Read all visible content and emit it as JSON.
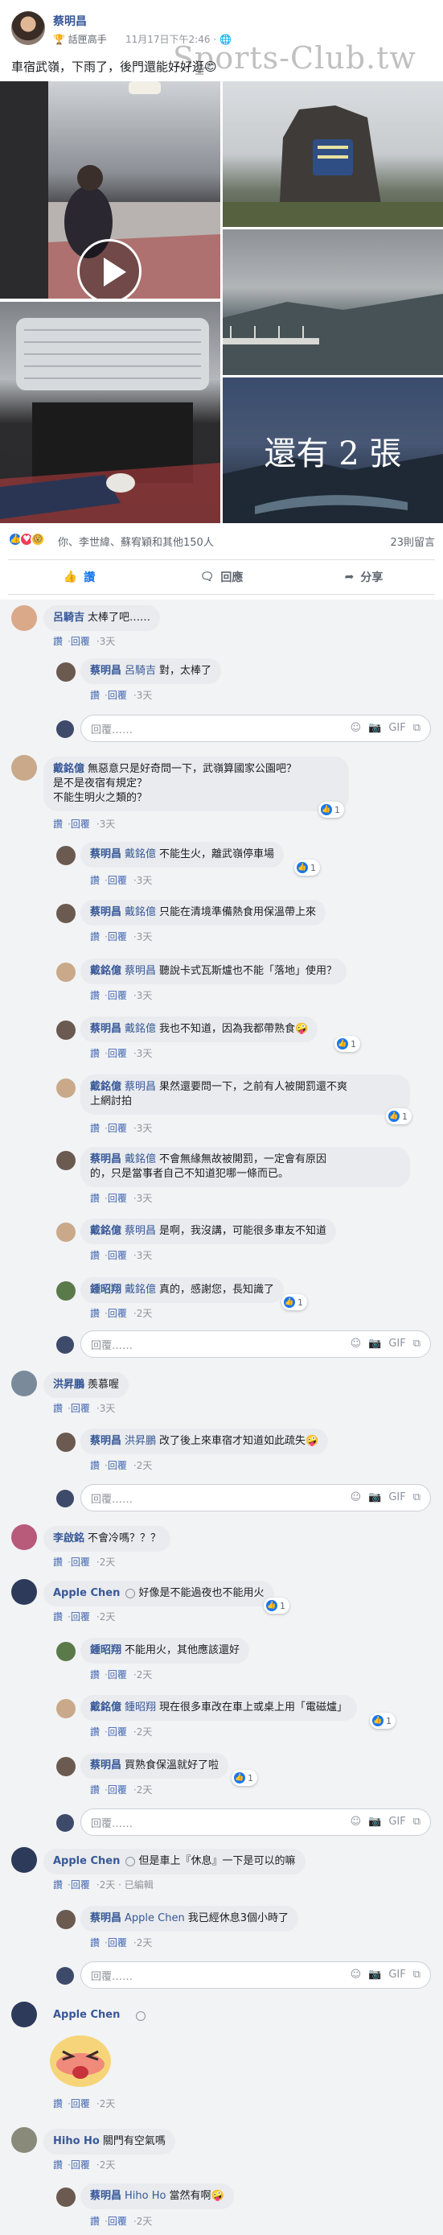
{
  "post": {
    "author": "蔡明昌",
    "badge": "話匣高手",
    "time": "11月17日下午2:46",
    "watermark": "Sports-Club.tw",
    "text": "車宿武嶺，下雨了，後門還能好好逛😊",
    "more_photos": "還有 2 張"
  },
  "reactions": {
    "summary": "你、李世緯、蘇宥穎和其他150人",
    "comment_count": "23則留言"
  },
  "actions": {
    "like": "讚",
    "comment": "回應",
    "share": "分享"
  },
  "ui": {
    "like": "讚",
    "reply": "回覆",
    "reply_placeholder": "回覆……",
    "edited": "已編輯"
  },
  "comments": [
    {
      "name": "呂騎吉",
      "text": "太棒了吧……",
      "time": "3天"
    },
    {
      "name": "蔡明昌",
      "tag": "呂騎吉",
      "text": "對，太棒了",
      "time": "3天"
    },
    {
      "name": "戴銘億",
      "text": "無惡意只是好奇問一下，武嶺算國家公園吧？",
      "text2": "是不是夜宿有規定？",
      "text3": "不能生明火之類的？",
      "likes": "1",
      "time": "3天"
    },
    {
      "name": "蔡明昌",
      "tag": "戴銘億",
      "text": "不能生火，離武嶺停車場",
      "likes": "1",
      "time": "3天"
    },
    {
      "name": "蔡明昌",
      "tag": "戴銘億",
      "text": "只能在清境準備熱食用保溫帶上來",
      "time": "3天"
    },
    {
      "name": "戴銘億",
      "tag": "蔡明昌",
      "text": "聽說卡式瓦斯爐也不能「落地」使用？",
      "time": "3天"
    },
    {
      "name": "蔡明昌",
      "tag": "戴銘億",
      "text": "我也不知道，因為我都帶熟食🤪",
      "likes": "1",
      "time": "3天"
    },
    {
      "name": "戴銘億",
      "tag": "蔡明昌",
      "text": "果然還要問一下，之前有人被開罰還不爽",
      "text2": "上網討拍",
      "likes": "1",
      "time": "3天"
    },
    {
      "name": "蔡明昌",
      "tag": "戴銘億",
      "text": "不會無緣無故被開罰，一定會有原因",
      "text2": "的，只是當事者自己不知道犯哪一條而已。",
      "time": "3天"
    },
    {
      "name": "戴銘億",
      "tag": "蔡明昌",
      "text": "是啊，我沒講，可能很多車友不知道",
      "time": "3天"
    },
    {
      "name": "鍾昭翔",
      "tag": "戴銘億",
      "text": "真的，感謝您，長知識了",
      "likes": "1",
      "time": "2天"
    },
    {
      "name": "洪昇鵬",
      "text": "羨慕喔",
      "time": "3天"
    },
    {
      "name": "蔡明昌",
      "tag": "洪昇鵬",
      "text": "改了後上來車宿才知道如此疏失🤪",
      "time": "2天"
    },
    {
      "name": "李啟銘",
      "text": "不會冷嗎？？？",
      "time": "2天"
    },
    {
      "name": "Apple Chen",
      "text": "好像是不能過夜也不能用火",
      "likes": "1",
      "time": "2天"
    },
    {
      "name": "鍾昭翔",
      "text": "不能用火，其他應該還好",
      "time": "2天"
    },
    {
      "name": "戴銘億",
      "tag": "鍾昭翔",
      "text": "現在很多車改在車上或桌上用「電磁爐」",
      "likes": "1",
      "time": "2天"
    },
    {
      "name": "蔡明昌",
      "text": "買熟食保溫就好了啦",
      "likes": "1",
      "time": "2天"
    },
    {
      "name": "Apple Chen",
      "text": "但是車上『休息』一下是可以的嘛",
      "time": "2天"
    },
    {
      "name": "蔡明昌",
      "tag": "Apple Chen",
      "text": "我已經休息3個小時了",
      "time": "2天"
    },
    {
      "name": "Apple Chen",
      "time": "2天"
    },
    {
      "name": "Hiho Ho",
      "text": "關門有空氣嗎",
      "time": "2天"
    },
    {
      "name": "蔡明昌",
      "tag": "Hiho Ho",
      "text": "當然有啊🤪",
      "time": "2天"
    }
  ],
  "colors": {
    "link": "#385898",
    "blue": "#1877f2",
    "bubble": "#e9ebee",
    "bg": "#f2f3f5"
  }
}
